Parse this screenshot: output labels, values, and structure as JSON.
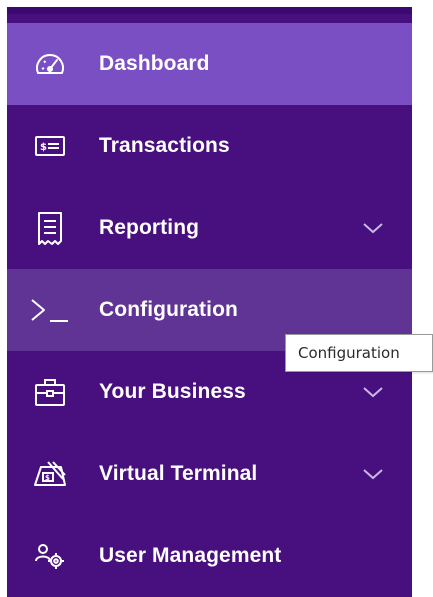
{
  "nav": {
    "items": [
      {
        "label": "Dashboard",
        "icon": "dashboard-gauge-icon",
        "state": "active",
        "has_chevron": false
      },
      {
        "label": "Transactions",
        "icon": "transactions-card-icon",
        "state": "default",
        "has_chevron": false
      },
      {
        "label": "Reporting",
        "icon": "reporting-receipt-icon",
        "state": "default",
        "has_chevron": true
      },
      {
        "label": "Configuration",
        "icon": "configuration-terminal-icon",
        "state": "hover",
        "has_chevron": false
      },
      {
        "label": "Your Business",
        "icon": "briefcase-icon",
        "state": "default",
        "has_chevron": true
      },
      {
        "label": "Virtual Terminal",
        "icon": "virtual-terminal-icon",
        "state": "default",
        "has_chevron": true
      },
      {
        "label": "User Management",
        "icon": "user-management-icon",
        "state": "default",
        "has_chevron": false
      }
    ]
  },
  "tooltip": {
    "text": "Configuration"
  },
  "colors": {
    "sidebar_bg": "#48107f",
    "active_bg": "#7b4fc4",
    "hover_bg": "#5f3494",
    "text": "#ffffff"
  }
}
